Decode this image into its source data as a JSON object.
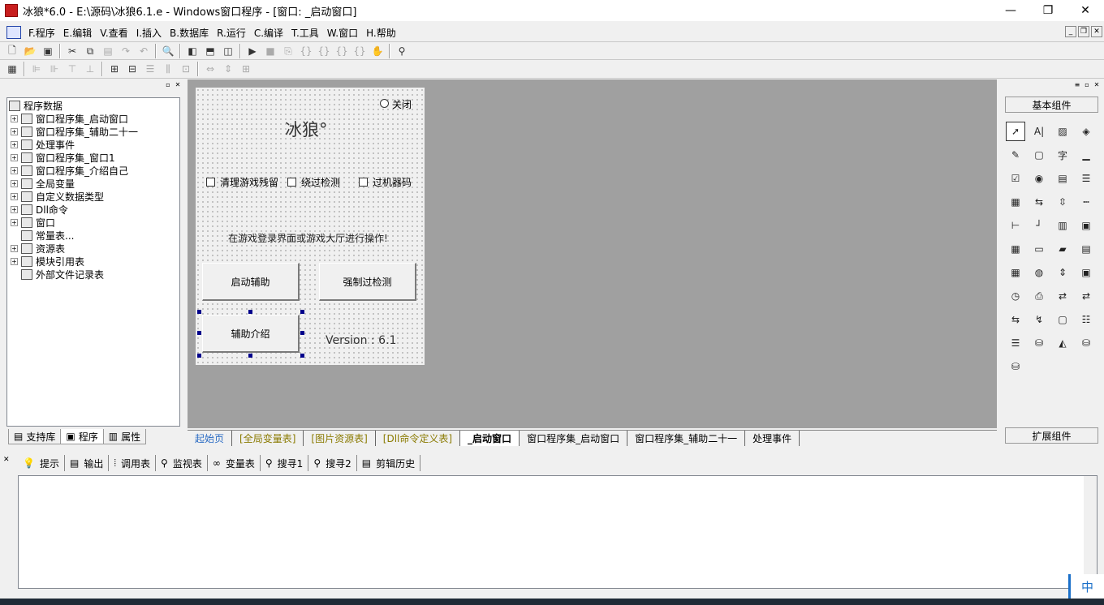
{
  "window": {
    "title": "冰狼*6.0 - E:\\源码\\冰狼6.1.e - Windows窗口程序 - [窗口: _启动窗口]",
    "controls": [
      "—",
      "❐",
      "✕"
    ]
  },
  "menu": [
    "F.程序",
    "E.编辑",
    "V.查看",
    "I.插入",
    "B.数据库",
    "R.运行",
    "C.编译",
    "T.工具",
    "W.窗口",
    "H.帮助"
  ],
  "mdi_controls": [
    "_",
    "❐",
    "✕"
  ],
  "tree": {
    "root": "程序数据",
    "items": [
      "窗口程序集_启动窗口",
      "窗口程序集_辅助二十一",
      "处理事件",
      "窗口程序集_窗口1",
      "窗口程序集_介绍自己",
      "全局变量",
      "自定义数据类型",
      "Dll命令",
      "窗口",
      "常量表...",
      "资源表",
      "模块引用表",
      "外部文件记录表"
    ]
  },
  "left_tabs": [
    "支持库",
    "程序",
    "属性"
  ],
  "form": {
    "radio_close": "关闭",
    "title": "冰狼°",
    "checkboxes": [
      "清理游戏残留",
      "绕过检测",
      "过机器码"
    ],
    "hint": "在游戏登录界面或游戏大厅进行操作!",
    "btn_start": "启动辅助",
    "btn_force": "强制过检测",
    "btn_intro": "辅助介绍",
    "version": "Version :  6.1"
  },
  "doc_tabs": [
    "起始页",
    "[全局变量表]",
    "[图片资源表]",
    "[Dll命令定义表]",
    "_启动窗口",
    "窗口程序集_启动窗口",
    "窗口程序集_辅助二十一",
    "处理事件"
  ],
  "right_panel": {
    "title": "基本组件",
    "extend": "扩展组件"
  },
  "bottom_tabs": [
    "提示",
    "输出",
    "调用表",
    "监视表",
    "变量表",
    "搜寻1",
    "搜寻2",
    "剪辑历史"
  ],
  "ime": "中"
}
